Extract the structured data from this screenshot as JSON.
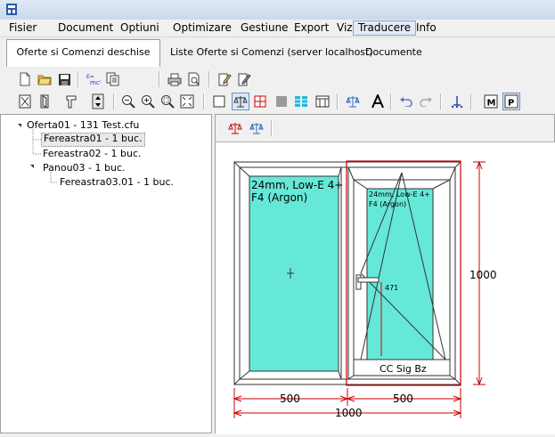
{
  "menu": {
    "items": [
      {
        "label": "Fisier"
      },
      {
        "label": "Document"
      },
      {
        "label": "Optiuni"
      },
      {
        "label": "Optimizare"
      },
      {
        "label": "Gestiune"
      },
      {
        "label": "Export"
      },
      {
        "label": "Vizibil"
      },
      {
        "label": "Traducere"
      },
      {
        "label": "Info"
      }
    ]
  },
  "tabs": {
    "items": [
      {
        "label": "Oferte si Comenzi deschise"
      },
      {
        "label": "Liste Oferte si Comenzi   (server localhost)"
      },
      {
        "label": "Documente"
      }
    ],
    "active": "Oferte si Comenzi deschise"
  },
  "tree": {
    "items": [
      {
        "label": "Oferta01 - 131 Test.cfu"
      },
      {
        "label": "Fereastra01 - 1 buc."
      },
      {
        "label": "Fereastra02 - 1 buc."
      },
      {
        "label": "Panou03 - 1 buc."
      },
      {
        "label": "Fereastra03.01 - 1 buc."
      }
    ]
  },
  "drawing": {
    "glass_left": {
      "line1": "24mm, Low-E 4+",
      "line2": "F4 (Argon)"
    },
    "glass_right": {
      "line1": "24mm, Low-E 4+",
      "line2": "F4 (Argon)"
    },
    "handle_height": "471",
    "sash_label": "CC Sig Bz",
    "dim_height": "1000",
    "dim_left": "500",
    "dim_right": "500",
    "dim_total": "1000"
  },
  "colors": {
    "glass": "#66e8d8",
    "selection": "#c00000",
    "accent": "#3a6ea5"
  }
}
